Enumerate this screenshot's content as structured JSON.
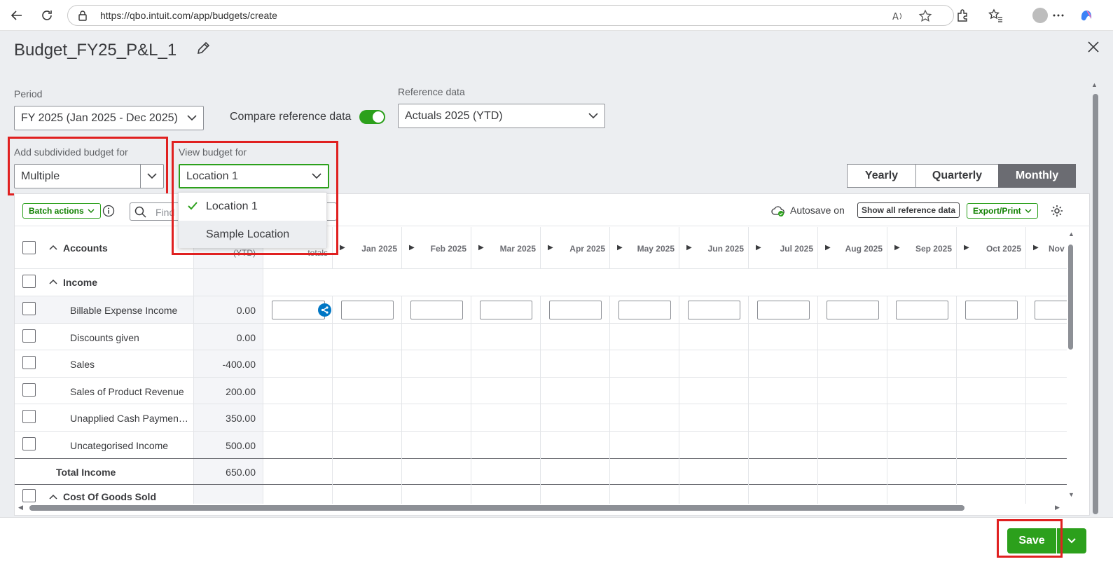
{
  "browser": {
    "url": "https://qbo.intuit.com/app/budgets/create"
  },
  "page": {
    "title": "Budget_FY25_P&L_1"
  },
  "filters": {
    "period_label": "Period",
    "period_value": "FY 2025 (Jan 2025 - Dec 2025)",
    "compare_label": "Compare reference data",
    "compare_on": true,
    "reference_label": "Reference data",
    "reference_value": "Actuals 2025 (YTD)",
    "subdivide_label": "Add subdivided budget for",
    "subdivide_value": "Multiple",
    "view_label": "View budget for",
    "view_value": "Location 1"
  },
  "view_dropdown": {
    "options": [
      "Location 1",
      "Sample Location"
    ],
    "selected_index": 0
  },
  "period_toggle": [
    "Yearly",
    "Quarterly",
    "Monthly"
  ],
  "period_toggle_active": "Monthly",
  "toolbar": {
    "batch_actions": "Batch actions",
    "find_placeholder": "Find",
    "autosave": "Autosave on",
    "show_all_reference": "Show all reference data",
    "export_print": "Export/Print"
  },
  "grid": {
    "accounts_header": "Accounts",
    "ytd_header": "(YTD)",
    "totals_header": "totals",
    "months": [
      "Jan 2025",
      "Feb 2025",
      "Mar 2025",
      "Apr 2025",
      "May 2025",
      "Jun 2025",
      "Jul 2025",
      "Aug 2025",
      "Sep 2025",
      "Oct 2025",
      "Nov"
    ],
    "income_group": "Income",
    "income_rows": [
      {
        "name": "Billable Expense Income",
        "ytd": "0.00"
      },
      {
        "name": "Discounts given",
        "ytd": "0.00"
      },
      {
        "name": "Sales",
        "ytd": "-400.00"
      },
      {
        "name": "Sales of Product Revenue",
        "ytd": "200.00"
      },
      {
        "name": "Unapplied Cash Paymen…",
        "ytd": "350.00"
      },
      {
        "name": "Uncategorised Income",
        "ytd": "500.00"
      }
    ],
    "total_income_label": "Total Income",
    "total_income_value": "650.00",
    "cogs_group": "Cost Of Goods Sold"
  },
  "footer": {
    "save_label": "Save"
  }
}
